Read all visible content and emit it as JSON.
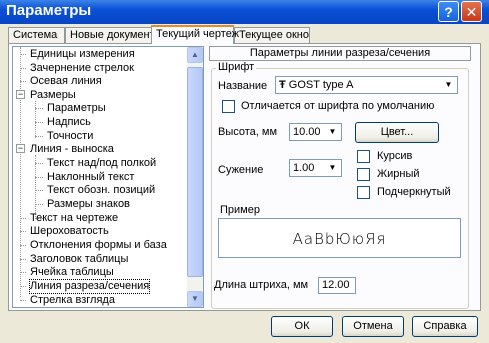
{
  "window": {
    "title": "Параметры",
    "help_glyph": "?",
    "close_glyph": "✕"
  },
  "tabs": [
    {
      "label": "Система"
    },
    {
      "label": "Новые документы"
    },
    {
      "label": "Текущий чертеж"
    },
    {
      "label": "Текущее окно"
    }
  ],
  "tree": {
    "items": [
      {
        "label": "Единицы измерения"
      },
      {
        "label": "Зачернение стрелок"
      },
      {
        "label": "Осевая линия"
      },
      {
        "label": "Размеры"
      },
      {
        "label": "Параметры"
      },
      {
        "label": "Надпись"
      },
      {
        "label": "Точности"
      },
      {
        "label": "Линия - выноска"
      },
      {
        "label": "Текст над/под полкой"
      },
      {
        "label": "Наклонный текст"
      },
      {
        "label": "Текст обозн. позиций"
      },
      {
        "label": "Размеры знаков"
      },
      {
        "label": "Текст на чертеже"
      },
      {
        "label": "Шероховатость"
      },
      {
        "label": "Отклонения формы и база"
      },
      {
        "label": "Заголовок таблицы"
      },
      {
        "label": "Ячейка таблицы"
      },
      {
        "label": "Линия разреза/сечения"
      },
      {
        "label": "Стрелка взгляда"
      }
    ],
    "minus": "−"
  },
  "panel": {
    "header": "Параметры линии разреза/сечения",
    "font_group": "Шрифт",
    "font_label": "Название",
    "font_value": "GOST type A",
    "font_icon": "Ŧ",
    "differs_label": "Отличается от шрифта по умолчанию",
    "height_label": "Высота, мм",
    "height_value": "10.00",
    "color_button": "Цвет...",
    "narrow_label": "Сужение",
    "narrow_value": "1.00",
    "italic_label": "Курсив",
    "bold_label": "Жирный",
    "underline_label": "Подчеркнутый",
    "sample_label": "Пример",
    "sample_text": "АаВbЮюЯя",
    "dash_label": "Длина штриха, мм",
    "dash_value": "12.00"
  },
  "buttons": {
    "ok": "ОК",
    "cancel": "Отмена",
    "help": "Справка"
  }
}
